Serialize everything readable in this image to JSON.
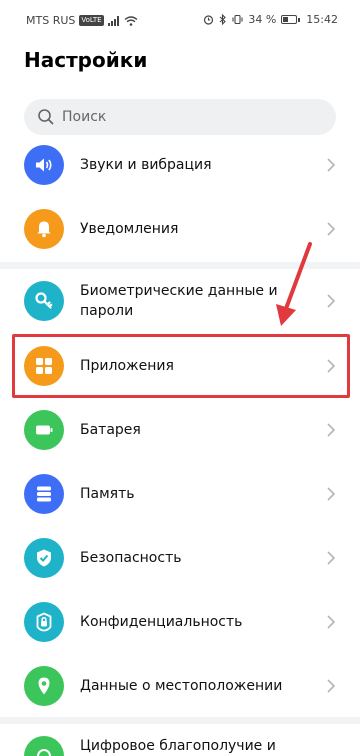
{
  "status_bar": {
    "carrier": "MTS RUS",
    "network_badge": "VoLTE",
    "battery_percent": "34 %",
    "battery_level": 0.34,
    "time": "15:42"
  },
  "page_title": "Настройки",
  "search": {
    "placeholder": "Поиск"
  },
  "items": [
    {
      "label": "Звуки и вибрация",
      "icon": "speaker-icon",
      "color": "#3f6ef6"
    },
    {
      "label": "Уведомления",
      "icon": "bell-icon",
      "color": "#f59a1b"
    },
    {
      "label": "Биометрические данные и пароли",
      "icon": "key-icon",
      "color": "#1eb3c9"
    },
    {
      "label": "Приложения",
      "icon": "apps-grid-icon",
      "color": "#f59a1b"
    },
    {
      "label": "Батарея",
      "icon": "battery-icon",
      "color": "#3bc55a"
    },
    {
      "label": "Память",
      "icon": "storage-icon",
      "color": "#3f6ef6"
    },
    {
      "label": "Безопасность",
      "icon": "shield-icon",
      "color": "#1eb3c9"
    },
    {
      "label": "Конфиденциальность",
      "icon": "privacy-lock-icon",
      "color": "#1eb3c9"
    },
    {
      "label": "Данные о местоположении",
      "icon": "location-pin-icon",
      "color": "#3bc55a"
    },
    {
      "label": "Цифровое благополучие и",
      "icon": "wellbeing-icon",
      "color": "#3bc55a"
    }
  ],
  "colors": {
    "highlight": "#e0393e",
    "chevron": "#b5b5b5"
  }
}
